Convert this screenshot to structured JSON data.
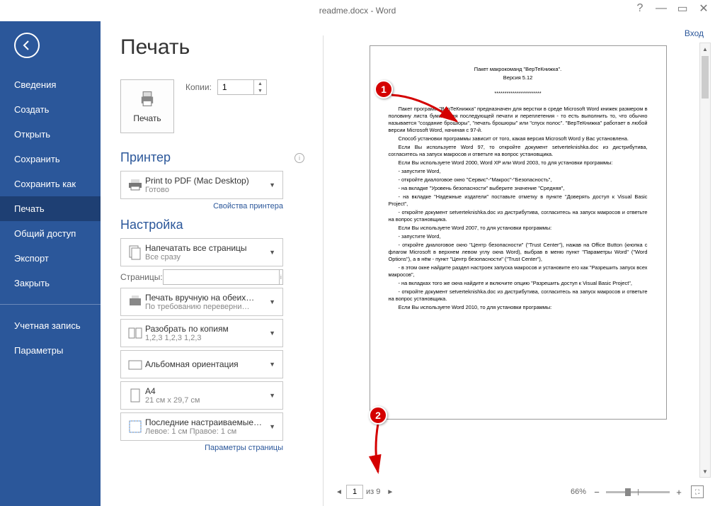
{
  "titlebar": {
    "title": "readme.docx - Word",
    "signin": "Вход"
  },
  "sidebar": {
    "items": [
      "Сведения",
      "Создать",
      "Открыть",
      "Сохранить",
      "Сохранить как",
      "Печать",
      "Общий доступ",
      "Экспорт",
      "Закрыть"
    ],
    "items2": [
      "Учетная запись",
      "Параметры"
    ],
    "active": 5
  },
  "page": {
    "title": "Печать",
    "print_btn": "Печать",
    "copies_label": "Копии:",
    "copies_value": "1",
    "printer_section": "Принтер",
    "printer_name": "Print to PDF (Mac Desktop)",
    "printer_status": "Готово",
    "printer_props": "Свойства принтера",
    "settings_section": "Настройка",
    "settings": [
      {
        "line1": "Напечатать все страницы",
        "line2": "Все сразу",
        "icon": "pages"
      },
      {
        "line1": "Печать вручную на обеих…",
        "line2": "По требованию переверни…",
        "icon": "duplex"
      },
      {
        "line1": "Разобрать по копиям",
        "line2": "1,2,3   1,2,3   1,2,3",
        "icon": "collate"
      },
      {
        "line1": "Альбомная ориентация",
        "line2": "",
        "icon": "landscape"
      },
      {
        "line1": "A4",
        "line2": "21 см x 29,7 см",
        "icon": "pagesize"
      },
      {
        "line1": "Последние настраиваемые…",
        "line2": "Левое: 1 см   Правое: 1 см",
        "icon": "margins"
      }
    ],
    "pages_label": "Страницы:",
    "page_setup": "Параметры страницы"
  },
  "preview": {
    "page_num": "1",
    "total": "из 9",
    "zoom": "66%",
    "doc": {
      "title": "Пакет макрокоманд \"ВерТеКнижка\".",
      "version": "Версия 5.12",
      "stars": "***********************",
      "body": [
        "Пакет программ \"ВерТеКнижка\" предназначен для верстки в среде Microsoft Word книжек размером в половину листа бумаги для последующей печати и переплетения - то есть выполнить то, что обычно называется \"создание брошюры\", \"печать брошюры\" или \"спуск полос\". \"ВерТеКнижка\" работает в любой версии Microsoft Word, начиная с 97-й.",
        "Способ установки программы зависит от того, какая версия Microsoft Word у Вас установлена.",
        "Если Вы используете Word 97, то откройте документ setverteknishka.doc из дистрибутива, согласитесь на запуск макросов и ответьте на вопрос установщика.",
        "Если Вы используете Word 2000, Word XP или Word 2003, то для установки программы:",
        "- запустите Word,",
        "- откройте диалоговое окно \"Сервис\"-\"Макрос\"-\"Безопасность\",",
        "- на вкладке \"Уровень безопасности\" выберите значение \"Средняя\",",
        "- на вкладке \"Надежные издатели\" поставьте отметку в пункте \"Доверять доступ к Visual Basic Project\",",
        "- откройте документ setverteknishka.doc из дистрибутива, согласитесь на запуск макросов и ответьте на вопрос установщика.",
        "Если Вы используете Word 2007, то для установки программы:",
        "- запустите Word,",
        "- откройте диалоговое окно \"Центр безопасности\" (\"Trust Center\"), нажав на Office Button (кнопка с флагом Microsoft в верхнем левом углу окна Word), выбрав в меню пункт \"Параметры Word\" (\"Word Options\"), а в нём - пункт \"Центр безопасности\" (\"Trust Center\"),",
        "- в этом окне найдите раздел настроек запуска макросов и установите его как \"Разрешить запуск всех макросов\",",
        "- на вкладках того же окна найдите и включите опцию \"Разрешить доступ к Visual Basic Project\",",
        "- откройте документ setverteknishka.doc из дистрибутива, согласитесь на запуск макросов и ответьте на вопрос установщика.",
        "Если Вы используете Word 2010, то для установки программы:"
      ]
    }
  },
  "annotations": {
    "a1": "1",
    "a2": "2"
  }
}
